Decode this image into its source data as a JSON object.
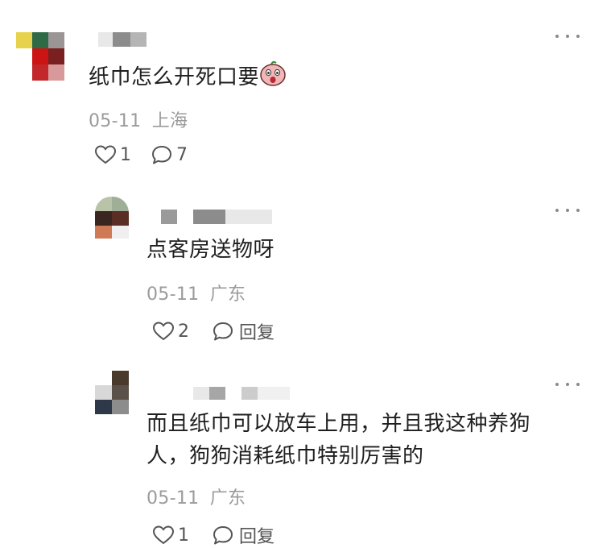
{
  "comments": [
    {
      "text": "纸巾怎么开死口要",
      "emoji_icon": "surprised-face-emoji-icon",
      "date": "05-11",
      "location": "上海",
      "likes": "1",
      "replies": "7"
    },
    {
      "text": "点客房送物呀",
      "date": "05-11",
      "location": "广东",
      "likes": "2",
      "reply_label": "回复"
    },
    {
      "text_line1": "而且纸巾可以放车上用，并且我这种养狗",
      "text_line2": "人，狗狗消耗纸巾特别厉害的",
      "date": "05-11",
      "location": "广东",
      "likes": "1",
      "reply_label": "回复"
    }
  ],
  "icons": {
    "like": "heart-outline-icon",
    "comment": "speech-bubble-icon",
    "more": "more-dots-icon"
  },
  "colors": {
    "text": "#1e1e1e",
    "meta": "#9b9b9b",
    "action": "#555555"
  }
}
